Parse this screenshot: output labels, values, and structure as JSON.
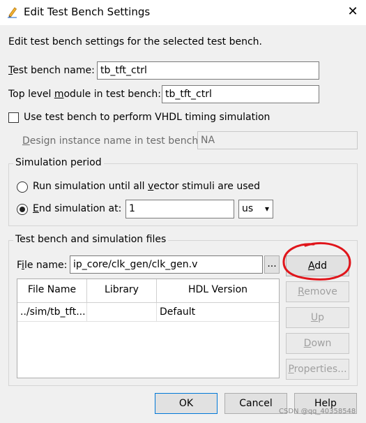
{
  "window": {
    "title": "Edit Test Bench Settings",
    "close_glyph": "✕"
  },
  "description": "Edit test bench settings for the selected test bench.",
  "test_bench_name": {
    "label_prefix": "T",
    "label_rest": "est bench name:",
    "value": "tb_tft_ctrl"
  },
  "top_level_module": {
    "label_pre": "Top level ",
    "label_u": "m",
    "label_post": "odule in test bench:",
    "value": "tb_tft_ctrl"
  },
  "vhdl_timing": {
    "label": "Use test bench to perform VHDL timing simulation",
    "checked": false
  },
  "design_instance": {
    "label_u": "D",
    "label_rest": "esign instance name in test bench:",
    "value": "NA"
  },
  "simulation_period": {
    "title": "Simulation period",
    "run_all": {
      "label_pre": "Run simulation until all ",
      "label_u": "v",
      "label_post": "ector stimuli are used",
      "selected": false
    },
    "end_at": {
      "label_u": "E",
      "label_rest": "nd simulation at:",
      "selected": true,
      "value": "1",
      "unit": "us",
      "unit_arrow": "▾"
    }
  },
  "files": {
    "title": "Test bench and simulation files",
    "file_name": {
      "label_pre": "F",
      "label_u": "i",
      "label_post": "le name:",
      "value": "ip_core/clk_gen/clk_gen.v",
      "browse": "..."
    },
    "columns": [
      "File Name",
      "Library",
      "HDL Version"
    ],
    "rows": [
      {
        "file": "../sim/tb_tft...",
        "library": "",
        "hdl": "Default"
      }
    ],
    "add": {
      "label_u": "A",
      "label_rest": "dd"
    },
    "remove": {
      "label_u": "R",
      "label_rest": "emove"
    },
    "up": {
      "label_u": "U",
      "label_rest": "p"
    },
    "down": {
      "label_u": "D",
      "label_rest": "own"
    },
    "properties": {
      "label_u": "P",
      "label_rest": "roperties..."
    }
  },
  "footer": {
    "ok": "OK",
    "cancel": "Cancel",
    "help": "Help"
  },
  "watermark": "CSDN @qq_40358548",
  "colors": {
    "annotation_circle": "#e0151b",
    "default_button_border": "#0078d7"
  }
}
